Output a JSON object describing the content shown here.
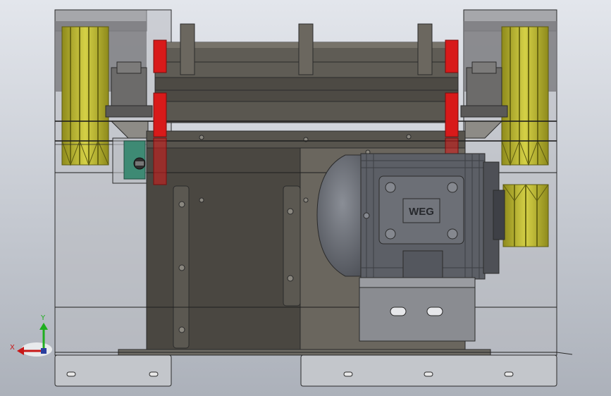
{
  "viewport": {
    "background_top": "#e3e6ec",
    "background_bottom": "#acb1ba"
  },
  "colors": {
    "frame_line": "#2b2b2b",
    "housing_dark": "#4a4741",
    "housing_mid": "#6a665e",
    "glass": "#b8bbc0",
    "pulley": "#c8c43c",
    "pulley_dark": "#7d7a16",
    "red_plate": "#d81a1a",
    "motor_body": "#5c5f66",
    "motor_dome": "#666a72",
    "green_box": "#3e8a74"
  },
  "motor": {
    "brand": "WEG"
  },
  "triad": {
    "y_label": "Y",
    "x_label": "X",
    "y_color": "#1fae1f",
    "x_color": "#c81818",
    "z_color": "#2a3f9f"
  }
}
